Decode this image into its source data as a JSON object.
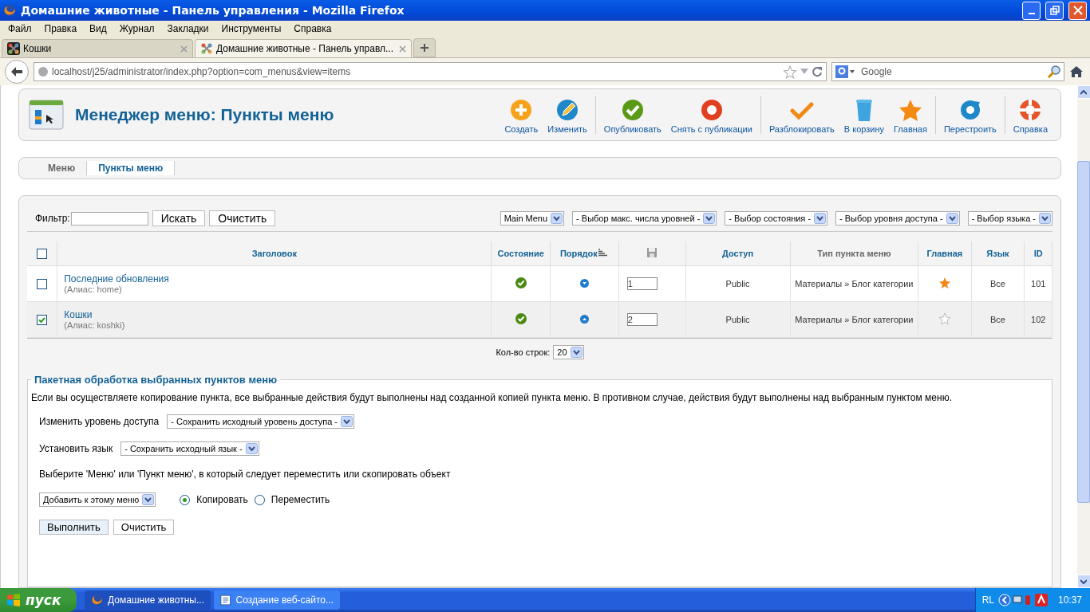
{
  "window": {
    "title": "Домашние животные - Панель управления - Mozilla Firefox"
  },
  "menu_bar": [
    "Файл",
    "Правка",
    "Вид",
    "Журнал",
    "Закладки",
    "Инструменты",
    "Справка"
  ],
  "browser_tabs": [
    {
      "label": "Кошки",
      "selected": false
    },
    {
      "label": "Домашние животные - Панель управл...",
      "selected": true
    }
  ],
  "address_bar": {
    "url": "localhost/j25/administrator/index.php?option=com_menus&view=items"
  },
  "search_box": {
    "placeholder": "Google"
  },
  "page": {
    "title": "Менеджер меню: Пункты меню",
    "toolbar": [
      [
        {
          "label": "Создать",
          "kind": "add"
        },
        {
          "label": "Изменить",
          "kind": "edit"
        }
      ],
      [
        {
          "label": "Опубликовать",
          "kind": "publish"
        },
        {
          "label": "Снять с публикации",
          "kind": "unpublish"
        }
      ],
      [
        {
          "label": "Разблокировать",
          "kind": "checkin"
        },
        {
          "label": "В корзину",
          "kind": "trash"
        },
        {
          "label": "Главная",
          "kind": "star"
        }
      ],
      [
        {
          "label": "Перестроить",
          "kind": "refresh"
        }
      ],
      [
        {
          "label": "Справка",
          "kind": "help"
        }
      ]
    ],
    "submenu": [
      {
        "label": "Меню",
        "selected": false
      },
      {
        "label": "Пункты меню",
        "selected": true
      }
    ],
    "filter": {
      "label": "Фильтр:",
      "buttons": [
        "Искать",
        "Очистить"
      ],
      "selects": [
        "Main Menu",
        "- Выбор макс. числа уровней -",
        "- Выбор состояния -",
        "- Выбор уровня доступа -",
        "- Выбор языка -"
      ]
    },
    "table": {
      "columns": [
        {
          "kind": "checkbox",
          "checked": false
        },
        {
          "kind": "text",
          "label": "Заголовок",
          "link": true
        },
        {
          "kind": "text",
          "label": "Состояние",
          "link": true
        },
        {
          "kind": "sort",
          "label": "Порядок",
          "link": true
        },
        {
          "kind": "save"
        },
        {
          "kind": "text",
          "label": "Доступ",
          "link": true
        },
        {
          "kind": "text",
          "label": "Тип пункта меню",
          "link": false
        },
        {
          "kind": "text",
          "label": "Главная",
          "link": true
        },
        {
          "kind": "text",
          "label": "Язык",
          "link": true
        },
        {
          "kind": "text",
          "label": "ID",
          "link": true
        }
      ],
      "rows": [
        {
          "checked": false,
          "title": "Последние обновления",
          "alias": "(Алиас: home)",
          "published": true,
          "move_up": false,
          "order": "1",
          "access": "Public",
          "type": "Материалы » Блог категории",
          "home": true,
          "language": "Все",
          "id": "101"
        },
        {
          "checked": true,
          "title": "Кошки",
          "alias": "(Алиас: koshki)",
          "published": true,
          "move_up": true,
          "order": "2",
          "access": "Public",
          "type": "Материалы » Блог категории",
          "home": false,
          "language": "Все",
          "id": "102"
        }
      ]
    },
    "pagination": {
      "label": "Кол-во строк:",
      "value": "20"
    },
    "batch": {
      "legend": "Пакетная обработка выбранных пунктов меню",
      "description": "Если вы осуществляете копирование пункта, все выбранные действия будут выполнены над созданной копией пункта меню. В противном случае, действия будут выполнены над выбранным пунктом меню.",
      "access_label": "Изменить уровень доступа",
      "access_value": "- Сохранить исходный уровень доступа -",
      "language_label": "Установить язык",
      "language_value": "- Сохранить исходный язык -",
      "move_label": "Выберите 'Меню' или 'Пункт меню', в который следует переместить или скопировать объект",
      "move_value": "Добавить к этому меню",
      "options": [
        {
          "label": "Копировать",
          "selected": true
        },
        {
          "label": "Переместить",
          "selected": false
        }
      ],
      "buttons": [
        "Выполнить",
        "Очистить"
      ]
    }
  },
  "taskbar": {
    "start": "пуск",
    "items": [
      {
        "label": "Домашние животны...",
        "kind": "browser",
        "selected": true
      },
      {
        "label": "Создание веб-сайто...",
        "kind": "document",
        "selected": false
      }
    ],
    "language": "RL",
    "time": "10:37"
  }
}
